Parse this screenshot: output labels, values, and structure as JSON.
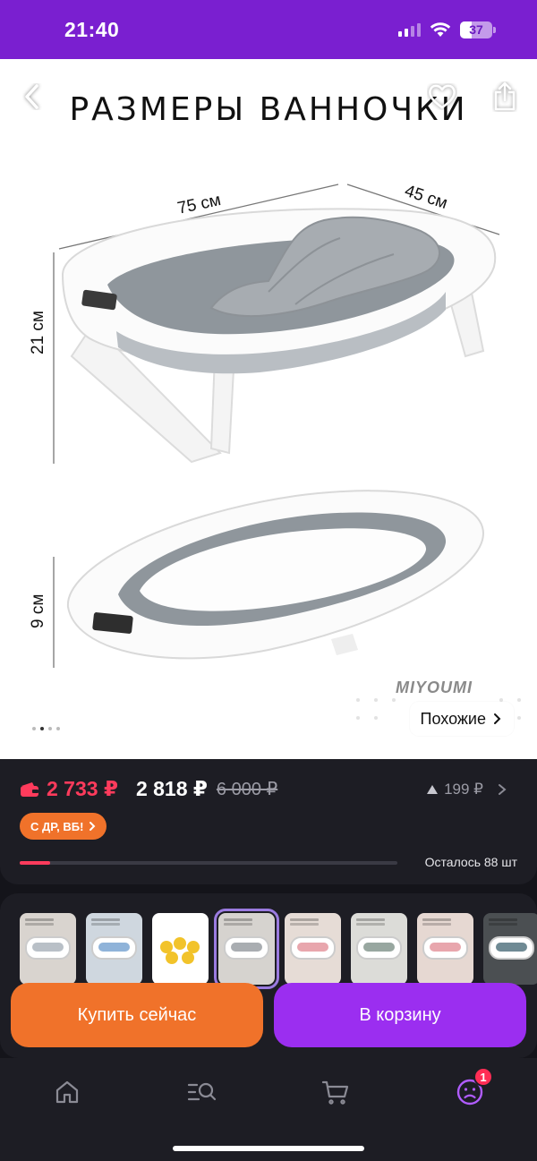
{
  "status_bar": {
    "time": "21:40",
    "battery": "37",
    "battery_level": 0.37
  },
  "gallery": {
    "title": "РАЗМЕРЫ ВАННОЧКИ",
    "dimensions": {
      "length": "75 см",
      "width": "45 см",
      "height_open": "21 см",
      "height_folded": "9 см"
    },
    "brand_watermark": "MIYOUMI",
    "similar_label": "Похожие",
    "slide_count": 4,
    "active_slide": 2
  },
  "price": {
    "wallet_price": "2 733 ₽",
    "price": "2 818 ₽",
    "old_price": "6 000 ₽",
    "points": "199 ₽",
    "promo_label": "С ДР, ВБ!",
    "stock_text": "Осталось 88 шт",
    "stock_level": 0.08
  },
  "thumbnails": [
    {
      "name": "thumb-1",
      "bg": "#d9d4cf",
      "accent": "#b9c0c7"
    },
    {
      "name": "thumb-2",
      "bg": "#cfd7df",
      "accent": "#8fb3d9"
    },
    {
      "name": "thumb-3",
      "bg": "#ffffff",
      "accent": "#f2c32a"
    },
    {
      "name": "thumb-4",
      "bg": "#d6d3cf",
      "accent": "#a9adb1"
    },
    {
      "name": "thumb-5",
      "bg": "#e6dcd6",
      "accent": "#e8a6ad"
    },
    {
      "name": "thumb-6",
      "bg": "#dcdcd8",
      "accent": "#98a7a0"
    },
    {
      "name": "thumb-7",
      "bg": "#e6d8d2",
      "accent": "#e8a6ad"
    },
    {
      "name": "thumb-8",
      "bg": "#4b4f52",
      "accent": "#6f8a94"
    }
  ],
  "selected_thumbnail": 3,
  "actions": {
    "buy_now": "Купить сейчас",
    "add_to_cart": "В корзину"
  },
  "tabbar": {
    "items": [
      "home-icon",
      "catalog-search-icon",
      "cart-icon",
      "profile-icon"
    ],
    "profile_badge": "1"
  },
  "colors": {
    "brand_purple": "#7a1fd0",
    "orange": "#f0722a",
    "cart_purple": "#9b2ef0",
    "sale_red": "#ff3b5c"
  }
}
